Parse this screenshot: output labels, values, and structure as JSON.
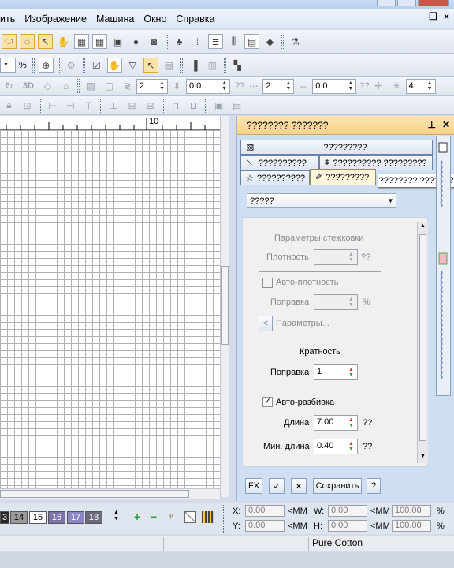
{
  "menu": [
    "ить",
    "Изображение",
    "Машина",
    "Окно",
    "Справка"
  ],
  "mdi_controls": [
    "_",
    "❐",
    "×"
  ],
  "toolbar2": {
    "zoom_suffix": "%"
  },
  "toolbar3": {
    "label_3d": "3D",
    "spin1": "2",
    "spin2": "0.0",
    "spin3_label": "??",
    "spin3": "2",
    "spin4": "0.0",
    "spin5_label": "??",
    "spin5": "4"
  },
  "ruler": {
    "mark": "10"
  },
  "panel": {
    "title": "???????? ???????",
    "tabs": [
      "?????????",
      "??????????",
      "?????????? ?????????",
      "??????????",
      "?????????"
    ],
    "tooltip": "???????? ???????",
    "combo_value": "?????",
    "section_title": "Параметры стежковки",
    "density_label": "Плотность",
    "density_unit": "??",
    "auto_density_label": "Авто-плотность",
    "correction_label1": "Поправка",
    "correction_unit1": "%",
    "params_button": "Параметры...",
    "multiplicity_title": "Кратность",
    "correction_label2": "Поправка",
    "correction_value2": "1",
    "auto_split_label": "Авто-разбивка",
    "auto_split_checked": "✓",
    "length_label": "Длина",
    "length_value": "7.00",
    "length_unit": "??",
    "minlen_label": "Мин. длина",
    "minlen_value": "0.40",
    "minlen_unit": "??",
    "btn_fx": "FX",
    "btn_check": "✓",
    "btn_x": "✕",
    "btn_save": "Сохранить",
    "btn_help": "?"
  },
  "swatches": [
    {
      "label": "3",
      "bg": "#2a2a2a",
      "fg": "#ffffff"
    },
    {
      "label": "14",
      "bg": "#9a9a9a",
      "fg": "#000000"
    },
    {
      "label": "15",
      "bg": "#ffffff",
      "fg": "#000000"
    },
    {
      "label": "16",
      "bg": "#7a74a8",
      "fg": "#ffffff"
    },
    {
      "label": "17",
      "bg": "#8b86c4",
      "fg": "#ffffff"
    },
    {
      "label": "18",
      "bg": "#6a6a7a",
      "fg": "#ffffff"
    }
  ],
  "coords": {
    "x_label": "X:",
    "x_value": "0.00",
    "y_label": "Y:",
    "y_value": "0.00",
    "unit1": "<MM",
    "w_label": "W:",
    "w_value": "0.00",
    "h_label": "H:",
    "h_value": "0.00",
    "unit2": "<MM",
    "pct_w": "100.00",
    "pct_h": "100.00",
    "pct_sign": "%"
  },
  "status": {
    "thread": "Pure Cotton"
  }
}
